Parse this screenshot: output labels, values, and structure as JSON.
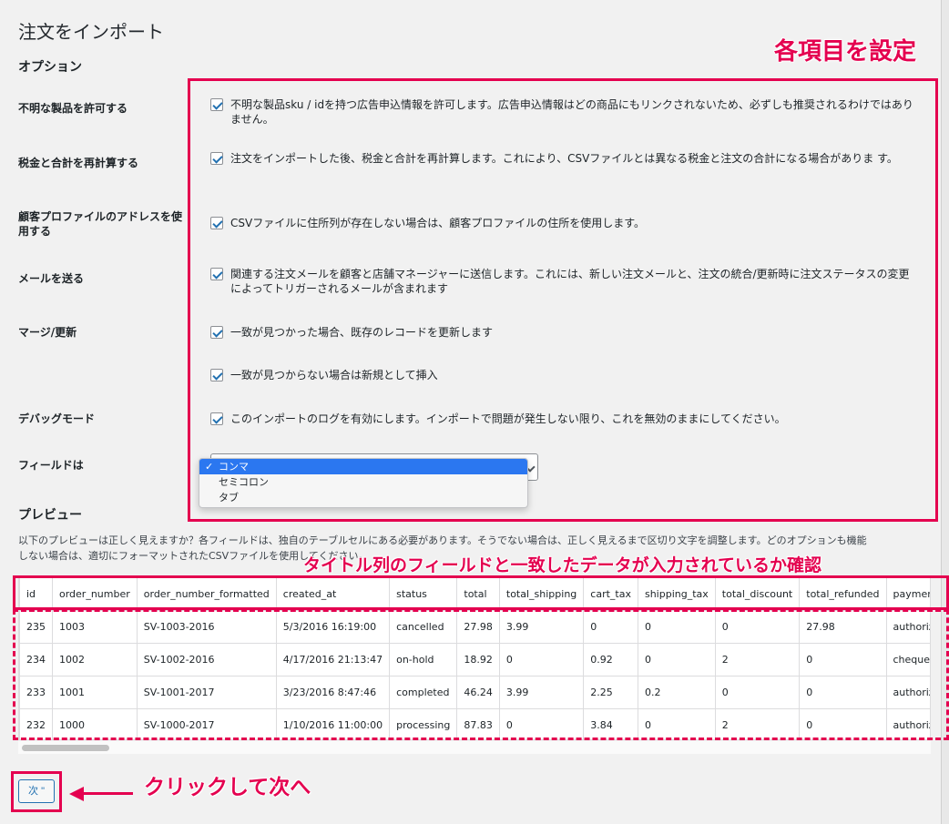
{
  "page": {
    "title": "注文をインポート",
    "options_heading": "オプション",
    "preview_heading": "プレビュー"
  },
  "options": [
    {
      "label": "不明な製品を許可する",
      "text": "不明な製品sku / idを持つ広告申込情報を許可します。広告申込情報はどの商品にもリンクされないため、必ずしも推奨されるわけではありません。",
      "checked": true
    },
    {
      "label": "税金と合計を再計算する",
      "text": "注文をインポートした後、税金と合計を再計算します。これにより、CSVファイルとは異なる税金と注文の合計になる場合がありま す。",
      "checked": true
    },
    {
      "label": "顧客プロファイルのアドレスを使用する",
      "text": "CSVファイルに住所列が存在しない場合は、顧客プロファイルの住所を使用します。",
      "checked": true
    },
    {
      "label": "メールを送る",
      "text": "関連する注文メールを顧客と店舗マネージャーに送信します。これには、新しい注文メールと、注文の統合/更新時に注文ステータスの変更によってトリガーされるメールが含まれます",
      "checked": true
    },
    {
      "label": "マージ/更新",
      "text": "一致が見つかった場合、既存のレコードを更新します",
      "checked": true
    },
    {
      "label": "",
      "text": "一致が見つからない場合は新規として挿入",
      "checked": true
    },
    {
      "label": "デバッグモード",
      "text": "このインポートのログを有効にします。インポートで問題が発生しない限り、これを無効のままにしてください。",
      "checked": true
    }
  ],
  "field_separator": {
    "label": "フィールドは",
    "options": [
      "コンマ",
      "セミコロン",
      "タブ"
    ],
    "selected": "コンマ"
  },
  "preview": {
    "description_line1": "以下のプレビューは正しく見えますか？各フィールドは、独自のテーブルセルにある必要があります。そうでない場合は、正しく見えるまで区切り文字を調整します。どのオプションも機能",
    "description_line2": "しない場合は、適切にフォーマットされたCSVファイルを使用してください。",
    "columns": [
      "id",
      "order_number",
      "order_number_formatted",
      "created_at",
      "status",
      "total",
      "total_shipping",
      "cart_tax",
      "shipping_tax",
      "total_discount",
      "total_refunded",
      "payment_"
    ],
    "rows": [
      [
        "235",
        "1003",
        "SV-1003-2016",
        "5/3/2016 16:19:00",
        "cancelled",
        "27.98",
        "3.99",
        "0",
        "0",
        "0",
        "27.98",
        "authorize_"
      ],
      [
        "234",
        "1002",
        "SV-1002-2016",
        "4/17/2016 21:13:47",
        "on-hold",
        "18.92",
        "0",
        "0.92",
        "0",
        "2",
        "0",
        "cheque"
      ],
      [
        "233",
        "1001",
        "SV-1001-2017",
        "3/23/2016 8:47:46",
        "completed",
        "46.24",
        "3.99",
        "2.25",
        "0.2",
        "0",
        "0",
        "authorize_"
      ],
      [
        "232",
        "1000",
        "SV-1000-2017",
        "1/10/2016 11:00:00",
        "processing",
        "87.83",
        "0",
        "3.84",
        "0",
        "2",
        "0",
        "authorize_"
      ]
    ]
  },
  "next_button": {
    "label": "次 \""
  },
  "annotations": {
    "settings": "各項目を設定",
    "verify": "タイトル列のフィールドと一致したデータが入力されているか確認",
    "click_next": "クリックして次へ",
    "color": "#e4004f"
  }
}
